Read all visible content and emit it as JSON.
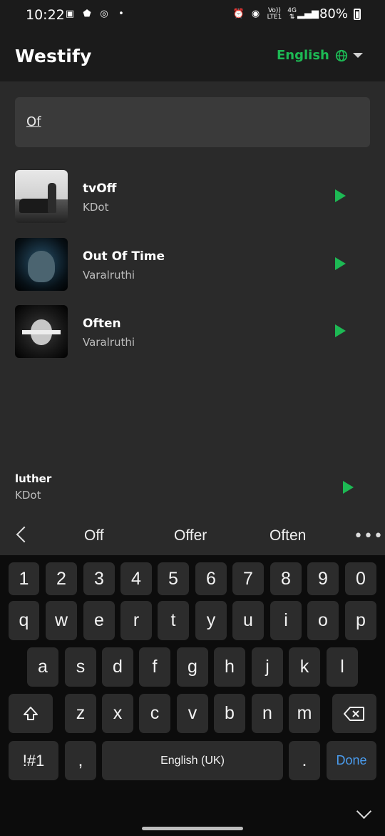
{
  "status_bar": {
    "time": "10:22",
    "network_top": "Vo))",
    "network_bottom": "LTE1",
    "data_top": "4G",
    "battery": "80%"
  },
  "header": {
    "app_title": "Westify",
    "language": "English"
  },
  "search": {
    "query": "Of"
  },
  "results": [
    {
      "title": "tvOff",
      "artist": "KDot"
    },
    {
      "title": "Out Of Time",
      "artist": "Varalruthi"
    },
    {
      "title": "Often",
      "artist": "Varalruthi"
    }
  ],
  "now_playing": {
    "title": "luther",
    "artist": "KDot"
  },
  "suggestions": [
    "Off",
    "Offer",
    "Often"
  ],
  "keyboard": {
    "numbers": [
      "1",
      "2",
      "3",
      "4",
      "5",
      "6",
      "7",
      "8",
      "9",
      "0"
    ],
    "row1": [
      "q",
      "w",
      "e",
      "r",
      "t",
      "y",
      "u",
      "i",
      "o",
      "p"
    ],
    "row2": [
      "a",
      "s",
      "d",
      "f",
      "g",
      "h",
      "j",
      "k",
      "l"
    ],
    "row3": [
      "z",
      "x",
      "c",
      "v",
      "b",
      "n",
      "m"
    ],
    "symbols_label": "!#1",
    "comma": ",",
    "space_label": "English (UK)",
    "period": ".",
    "done_label": "Done"
  },
  "colors": {
    "accent": "#1db954",
    "background": "#2a2a2a",
    "header_background": "#1b1b1b",
    "keyboard_background": "#0c0c0c",
    "done_text": "#4a9df0"
  }
}
